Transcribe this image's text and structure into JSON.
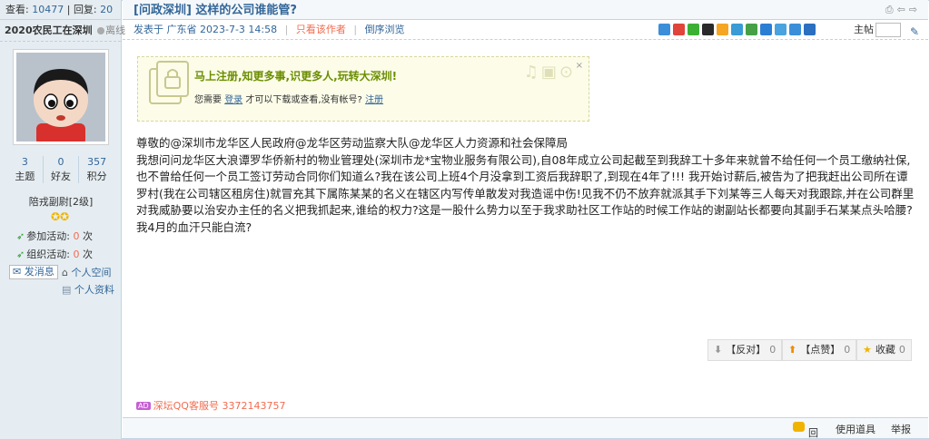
{
  "stats_bar": {
    "views_label": "查看:",
    "views": "10477",
    "sep": "|",
    "replies_label": "回复:",
    "replies": "20"
  },
  "thread": {
    "title": "[问政深圳] 这样的公司谁能管?"
  },
  "meta": {
    "posted": "发表于 广东省 2023-7-3 14:58",
    "only_author": "只看该作者",
    "reverse": "倒序浏览",
    "floor": "主帖"
  },
  "author": {
    "name": "2020农民工在深圳",
    "status": "离线",
    "topics": "3",
    "topics_label": "主题",
    "friends": "0",
    "friends_label": "好友",
    "points": "357",
    "points_label": "积分",
    "rank": "陪戎副尉[2级]",
    "activity1_label": "参加活动:",
    "activity1_value": "0",
    "activity2_label": "组织活动:",
    "activity2_value": "0",
    "unit": "次",
    "send_msg": "发消息",
    "space": "个人空间",
    "profile": "个人资料"
  },
  "notice": {
    "headline": "马上注册,知更多事,识更多人,玩转大深圳!",
    "pre": "您需要",
    "login": "登录",
    "mid": "才可以下载或查看,没有帐号?",
    "register": "注册"
  },
  "post": {
    "paragraphs": [
      "尊敬的@深圳市龙华区人民政府@龙华区劳动监察大队@龙华区人力资源和社会保障局",
      "我想问问龙华区大浪谭罗华侨新村的物业管理处(深圳市龙*宝物业服务有限公司),自08年成立公司起截至到我辞工十多年来就曾不给任何一个员工缴纳社保,也不曾给任何一个员工签订劳动合同你们知道么?我在该公司上班4个月没拿到工资后我辞职了,到现在4年了!!! 我开始讨薪后,被告为了把我赶出公司所在谭罗村(我在公司辖区租房住)就冒充其下属陈某某的名义在辖区内写传单散发对我造谣中伤!见我不仍不放弃就派其手下刘某等三人每天对我跟踪,并在公司群里对我威胁要以治安办主任的名义把我抓起来,谁给的权力?这是一股什么势力以至于我求助社区工作站的时候工作站的谢副站长都要向其副手石某某点头哈腰?我4月的血汗只能白流?"
    ]
  },
  "votes": {
    "oppose": "【反对】",
    "oppose_count": "0",
    "support": "【点赞】",
    "support_count": "0",
    "favorite": "收藏",
    "favorite_count": "0"
  },
  "ad": {
    "tag": "AD",
    "text": "深坛QQ客服号 3372143757"
  },
  "bottom": {
    "reply": "回复",
    "tools": "使用道具",
    "report": "举报"
  }
}
